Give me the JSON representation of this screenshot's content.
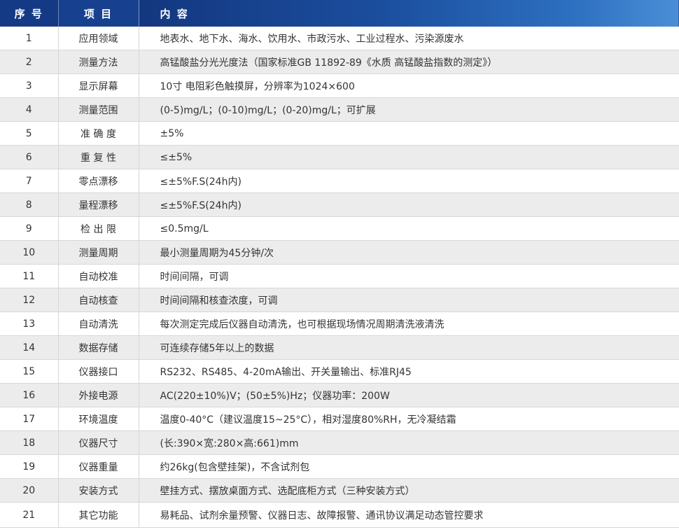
{
  "table": {
    "headers": {
      "no": "序 号",
      "item": "项 目",
      "content": "内 容"
    },
    "rows": [
      {
        "no": "1",
        "item": "应用领域",
        "content": "地表水、地下水、海水、饮用水、市政污水、工业过程水、污染源废水"
      },
      {
        "no": "2",
        "item": "测量方法",
        "content": "高锰酸盐分光光度法（国家标准GB 11892-89《水质 高锰酸盐指数的测定》）"
      },
      {
        "no": "3",
        "item": "显示屏幕",
        "content": "10寸 电阻彩色触摸屏，分辨率为1024×600"
      },
      {
        "no": "4",
        "item": "测量范围",
        "content": "(0-5)mg/L；(0-10)mg/L；(0-20)mg/L；可扩展"
      },
      {
        "no": "5",
        "item": "准 确 度",
        "content": "±5%"
      },
      {
        "no": "6",
        "item": "重 复 性",
        "content": "≤±5%"
      },
      {
        "no": "7",
        "item": "零点漂移",
        "content": "≤±5%F.S(24h内)"
      },
      {
        "no": "8",
        "item": "量程漂移",
        "content": "≤±5%F.S(24h内)"
      },
      {
        "no": "9",
        "item": "检 出 限",
        "content": "≤0.5mg/L"
      },
      {
        "no": "10",
        "item": "测量周期",
        "content": "最小测量周期为45分钟/次"
      },
      {
        "no": "11",
        "item": "自动校准",
        "content": "时间间隔，可调"
      },
      {
        "no": "12",
        "item": "自动核查",
        "content": "时间间隔和核查浓度，可调"
      },
      {
        "no": "13",
        "item": "自动清洗",
        "content": "每次测定完成后仪器自动清洗，也可根据现场情况周期清洗液清洗"
      },
      {
        "no": "14",
        "item": "数据存储",
        "content": "可连续存储5年以上的数据"
      },
      {
        "no": "15",
        "item": "仪器接口",
        "content": "RS232、RS485、4-20mA输出、开关量输出、标准RJ45"
      },
      {
        "no": "16",
        "item": "外接电源",
        "content": "AC(220±10%)V；(50±5%)Hz；仪器功率：200W"
      },
      {
        "no": "17",
        "item": "环境温度",
        "content": "温度0-40°C（建议温度15~25°C），相对湿度80%RH，无冷凝结霜"
      },
      {
        "no": "18",
        "item": "仪器尺寸",
        "content": "(长:390×宽:280×高:661)mm"
      },
      {
        "no": "19",
        "item": "仪器重量",
        "content": "约26kg(包含壁挂架)，不含试剂包"
      },
      {
        "no": "20",
        "item": "安装方式",
        "content": "壁挂方式、摆放桌面方式、选配底柜方式（三种安装方式）"
      },
      {
        "no": "21",
        "item": "其它功能",
        "content": "易耗品、试剂余量预警、仪器日志、故障报警、通讯协议满足动态管控要求"
      }
    ]
  },
  "colors": {
    "header_dark": "#143a86",
    "header_light": "#4a8ed6",
    "row_alt": "#ececec",
    "border": "#d7d7d7"
  }
}
